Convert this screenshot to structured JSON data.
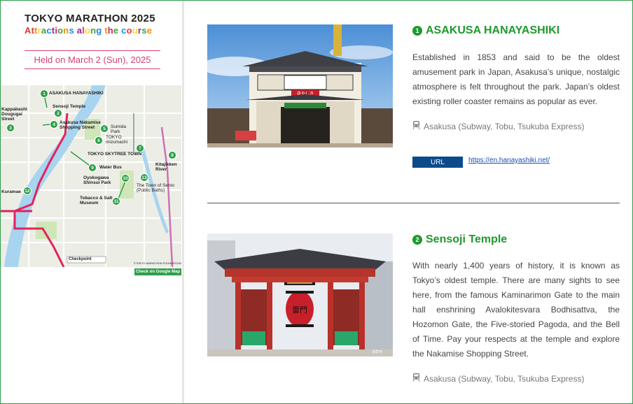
{
  "sidebar": {
    "title": "TOKYO MARATHON 2025",
    "subtitle_letters": [
      "A",
      "t",
      "t",
      "r",
      "a",
      "c",
      "t",
      "i",
      "o",
      "n",
      "s",
      " ",
      "a",
      "l",
      "o",
      "n",
      "g",
      " ",
      "t",
      "h",
      "e",
      " ",
      "c",
      "o",
      "u",
      "r",
      "s",
      "e"
    ],
    "subtitle_colors": [
      "#e53935",
      "#e53935",
      "#fb8c00",
      "#fdd835",
      "#43a047",
      "#1e88e5",
      "#8e24aa",
      "#d81b60",
      "#43a047",
      "#fb8c00",
      "#1e88e5",
      "#ffffff",
      "#8e24aa",
      "#e53935",
      "#fdd835",
      "#43a047",
      "#1e88e5",
      "#ffffff",
      "#fb8c00",
      "#d81b60",
      "#43a047",
      "#ffffff",
      "#1e88e5",
      "#e53935",
      "#fdd835",
      "#8e24aa",
      "#43a047",
      "#fb8c00"
    ],
    "held": "Held on March 2 (Sun), 2025",
    "map_button": "Check on Google Map"
  },
  "map": {
    "labels": {
      "l1": "ASAKUSA HANAYASHIKI",
      "l2": "Sensoji Temple",
      "l3": "Kappabashi Dougugai Street",
      "l4": "Asakusa Nakamise Shopping Street",
      "l5": "Sumida Park",
      "l6": "TOKYO mizumachi",
      "l7": "TOKYO SKYTREE TOWN",
      "l9": "Water Bus",
      "l8": "Kitajikken River",
      "l10": "Oyokogawa Shinsui Park",
      "l11": "Tobacco & Salt Museum",
      "l12": "Kuramae",
      "l13": "The Town of Sento (Public Baths)",
      "checkpoint": "Checkpoint",
      "credit": "©TOKYO MARATHON FOUNDATION"
    },
    "markers": [
      "1",
      "2",
      "3",
      "4",
      "5",
      "6",
      "7",
      "8",
      "9",
      "10",
      "11",
      "12",
      "13"
    ]
  },
  "attractions": [
    {
      "number": "1",
      "name": "ASAKUSA HANAYASHIKI",
      "description": "Established in 1853 and said to be the oldest amusement park in Japan, Asakusa’s unique, nostalgic atmosphere is felt throughout the park. Japan’s oldest existing roller coaster remains as popular as ever.",
      "access": "Asakusa (Subway, Tobu, Tsukuba Express)",
      "url_label": "URL",
      "url": "https://en.hanayashiki.net/",
      "sign_text": "花やしき"
    },
    {
      "number": "2",
      "name": "Sensoji Temple",
      "description": "With nearly 1,400 years of history, it is known as Tokyo’s oldest temple. There are many sights to see here, from the famous Kaminarimon Gate to the main hall enshrining Avalokitesvara Bodhisattva, the Hozomon Gate, the Five-storied Pagoda, and the Bell of Time. Pay your respects at the temple and explore the Nakamise Shopping Street.",
      "access": "Asakusa (Subway, Tobu, Tsukuba Express)",
      "sign_text": "雷門",
      "photo_credit": "浅草寺"
    }
  ],
  "colors": {
    "accent_green": "#1e9a2c",
    "pink": "#d63f72",
    "url_badge": "#0c4a8c",
    "river": "#a8d4ef"
  }
}
